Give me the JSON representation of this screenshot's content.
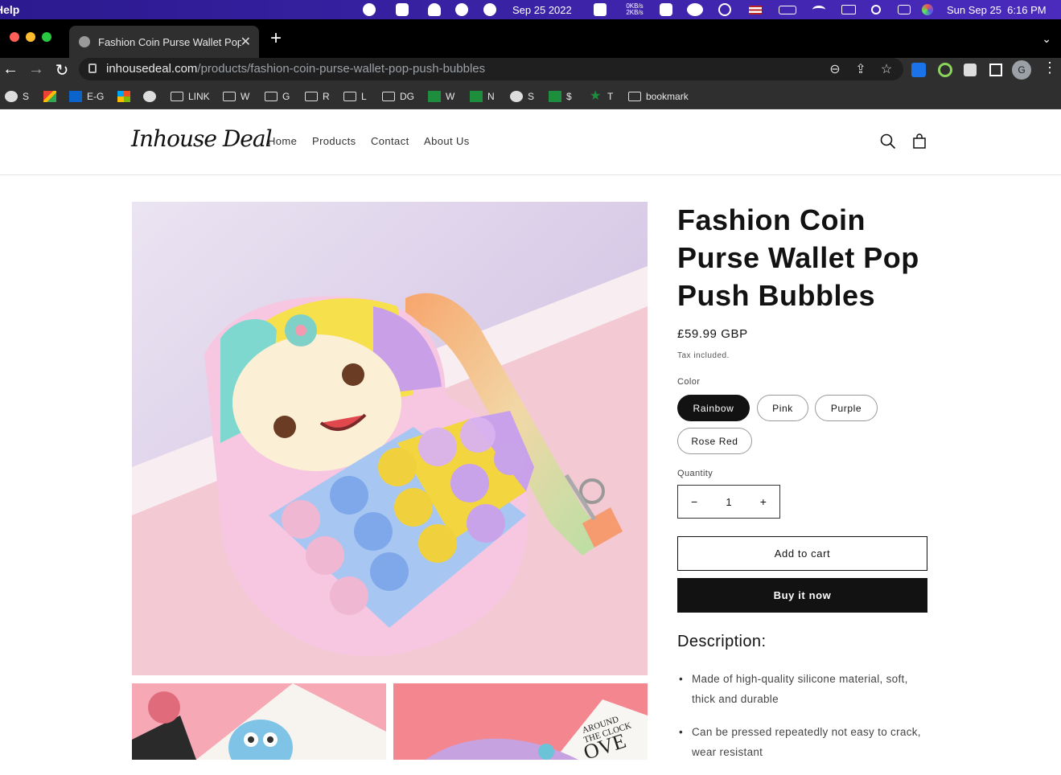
{
  "menubar": {
    "app_menu": "Help",
    "date_short": "Sep 25 2022",
    "net_up": "0KB/s",
    "net_down": "2KB/s",
    "clock": "Sun Sep 25  6:16 PM"
  },
  "browser": {
    "tab_title": "Fashion Coin Purse Wallet Pop",
    "url_host": "inhousedeal.com",
    "url_path": "/products/fashion-coin-purse-wallet-pop-push-bubbles",
    "profile_initial": "G",
    "bookmarks": [
      {
        "icon": "globe",
        "label": "S"
      },
      {
        "icon": "gmail",
        "label": ""
      },
      {
        "icon": "outlook",
        "label": "E-G"
      },
      {
        "icon": "ms",
        "label": ""
      },
      {
        "icon": "globe",
        "label": ""
      },
      {
        "icon": "folder",
        "label": "LINK"
      },
      {
        "icon": "folder",
        "label": "W"
      },
      {
        "icon": "folder",
        "label": "G"
      },
      {
        "icon": "folder",
        "label": "R"
      },
      {
        "icon": "folder",
        "label": "L"
      },
      {
        "icon": "folder",
        "label": "DG"
      },
      {
        "icon": "sheet",
        "label": "W"
      },
      {
        "icon": "sheet",
        "label": "N"
      },
      {
        "icon": "globe",
        "label": "S"
      },
      {
        "icon": "sheet",
        "label": "$"
      },
      {
        "icon": "star",
        "label": "T"
      },
      {
        "icon": "folder",
        "label": "bookmark"
      }
    ]
  },
  "site": {
    "logo": "Inhouse Deal",
    "nav": [
      "Home",
      "Products",
      "Contact",
      "About Us"
    ]
  },
  "product": {
    "title": "Fashion Coin Purse Wallet Pop Push Bubbles",
    "price": "£59.99 GBP",
    "tax_note": "Tax included.",
    "color_label": "Color",
    "colors": [
      "Rainbow",
      "Pink",
      "Purple",
      "Rose Red"
    ],
    "selected_color": "Rainbow",
    "quantity_label": "Quantity",
    "quantity": "1",
    "qty_minus": "−",
    "qty_plus": "+",
    "add_to_cart": "Add to cart",
    "buy_now": "Buy it now",
    "description_title": "Description:",
    "description_items": [
      "Made of high-quality silicone material, soft, thick and durable",
      "Can be pressed repeatedly not easy to crack, wear resistant"
    ]
  },
  "colors": {
    "accent_dark": "#121212",
    "menubar_bg": "#3b1fa3"
  }
}
